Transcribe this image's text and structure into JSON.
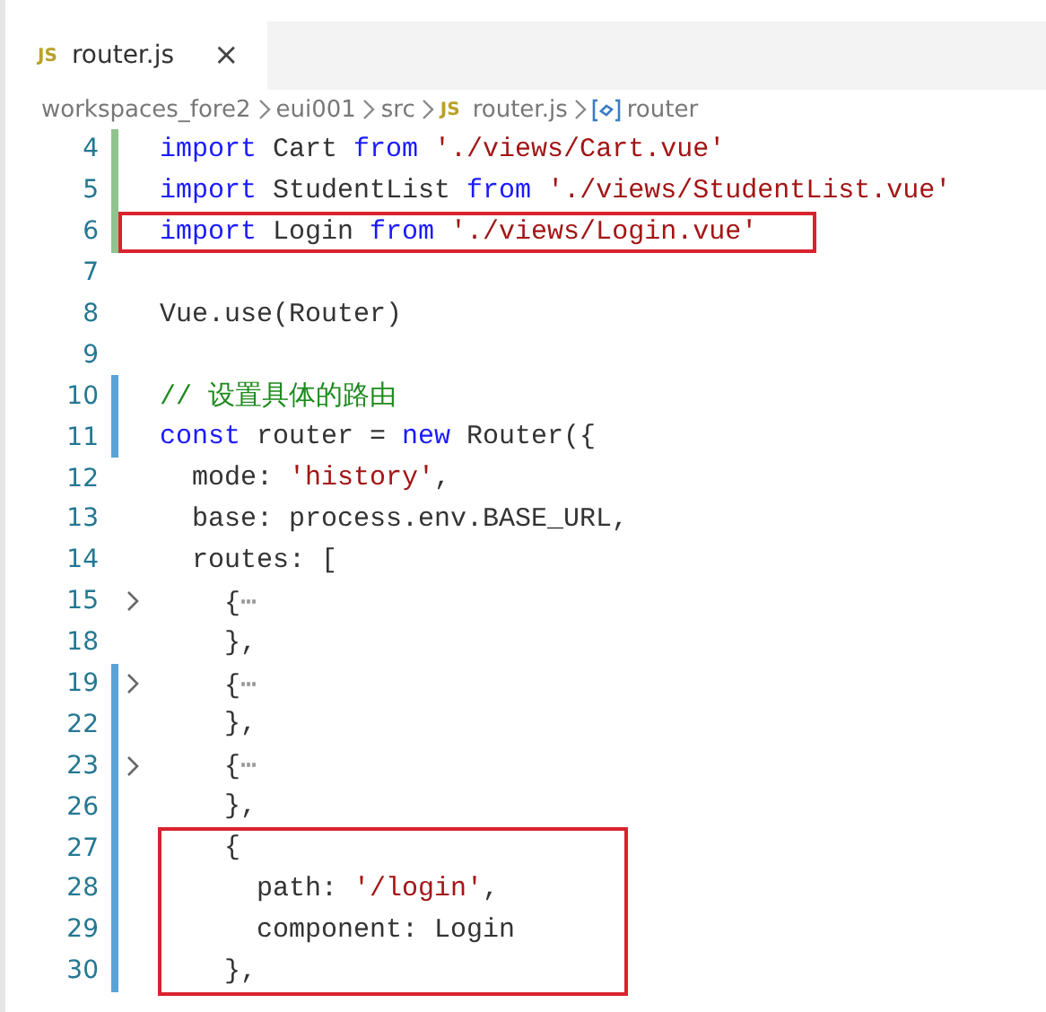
{
  "tabs": [
    {
      "badge": "JS",
      "label": "router.js",
      "close": "×",
      "selected": true
    }
  ],
  "breadcrumb": [
    {
      "kind": "folder",
      "text": "workspaces_fore2"
    },
    {
      "kind": "folder",
      "text": "eui001"
    },
    {
      "kind": "folder",
      "text": "src"
    },
    {
      "kind": "file",
      "badge": "JS",
      "text": "router.js"
    },
    {
      "kind": "symbol",
      "text": "router"
    }
  ],
  "lines": [
    {
      "number": "4",
      "added": true,
      "modified": false,
      "fold": false,
      "boxed": false,
      "tokens": [
        {
          "kind": "keyword",
          "text": "import"
        },
        {
          "kind": "plain",
          "text": " Cart "
        },
        {
          "kind": "keyword",
          "text": "from"
        },
        {
          "kind": "string",
          "text": " './views/Cart.vue'"
        }
      ]
    },
    {
      "number": "5",
      "added": true,
      "modified": false,
      "fold": false,
      "boxed": false,
      "tokens": [
        {
          "kind": "keyword",
          "text": "import"
        },
        {
          "kind": "plain",
          "text": " StudentList "
        },
        {
          "kind": "keyword",
          "text": "from"
        },
        {
          "kind": "string",
          "text": " './views/StudentList.vue'"
        }
      ]
    },
    {
      "number": "6",
      "added": true,
      "modified": false,
      "fold": false,
      "boxed": true,
      "tokens": [
        {
          "kind": "keyword",
          "text": "import"
        },
        {
          "kind": "plain",
          "text": " Login "
        },
        {
          "kind": "keyword",
          "text": "from"
        },
        {
          "kind": "string",
          "text": " './views/Login.vue'"
        }
      ]
    },
    {
      "number": "7",
      "added": false,
      "modified": false,
      "fold": false,
      "boxed": false
    },
    {
      "number": "8",
      "added": false,
      "modified": false,
      "fold": false,
      "boxed": false,
      "tokens": [
        {
          "kind": "plain",
          "text": "Vue.use(Router)"
        }
      ]
    },
    {
      "number": "9",
      "added": false,
      "modified": false,
      "fold": false,
      "boxed": false
    },
    {
      "number": "10",
      "added": false,
      "modified": true,
      "fold": false,
      "boxed": false,
      "tokens": [
        {
          "kind": "comment",
          "text": "// 设置具体的路由"
        }
      ]
    },
    {
      "number": "11",
      "added": false,
      "modified": true,
      "fold": false,
      "boxed": false,
      "tokens": [
        {
          "kind": "keyword",
          "text": "const"
        },
        {
          "kind": "plain",
          "text": " router = "
        },
        {
          "kind": "keyword",
          "text": "new"
        },
        {
          "kind": "plain",
          "text": " Router({"
        }
      ]
    },
    {
      "number": "12",
      "added": false,
      "modified": false,
      "fold": false,
      "boxed": false,
      "tokens": [
        {
          "kind": "plain",
          "text": "  mode: "
        },
        {
          "kind": "string",
          "text": "'history'"
        },
        {
          "kind": "plain",
          "text": ","
        }
      ]
    },
    {
      "number": "13",
      "added": false,
      "modified": false,
      "fold": false,
      "boxed": false,
      "tokens": [
        {
          "kind": "plain",
          "text": "  base: process.env.BASE_URL,"
        }
      ]
    },
    {
      "number": "14",
      "added": false,
      "modified": false,
      "fold": false,
      "boxed": false,
      "tokens": [
        {
          "kind": "plain",
          "text": "  routes: ["
        }
      ]
    },
    {
      "number": "15",
      "added": false,
      "modified": false,
      "fold": true,
      "boxed": false,
      "tokens": [
        {
          "kind": "plain",
          "text": "    {"
        },
        {
          "kind": "ellipsis",
          "text": "⋯"
        }
      ]
    },
    {
      "number": "18",
      "added": false,
      "modified": false,
      "fold": false,
      "boxed": false,
      "tokens": [
        {
          "kind": "plain",
          "text": "    },"
        }
      ]
    },
    {
      "number": "19",
      "added": false,
      "modified": true,
      "fold": true,
      "boxed": false,
      "tokens": [
        {
          "kind": "plain",
          "text": "    {"
        },
        {
          "kind": "ellipsis",
          "text": "⋯"
        }
      ]
    },
    {
      "number": "22",
      "added": false,
      "modified": true,
      "fold": false,
      "boxed": false,
      "tokens": [
        {
          "kind": "plain",
          "text": "    },"
        }
      ]
    },
    {
      "number": "23",
      "added": false,
      "modified": true,
      "fold": true,
      "boxed": false,
      "tokens": [
        {
          "kind": "plain",
          "text": "    {"
        },
        {
          "kind": "ellipsis",
          "text": "⋯"
        }
      ]
    },
    {
      "number": "26",
      "added": false,
      "modified": true,
      "fold": false,
      "boxed": false,
      "tokens": [
        {
          "kind": "plain",
          "text": "    },"
        }
      ]
    },
    {
      "number": "27",
      "added": false,
      "modified": true,
      "fold": false,
      "boxed": true,
      "tokens": [
        {
          "kind": "plain",
          "text": "    {"
        }
      ]
    },
    {
      "number": "28",
      "added": false,
      "modified": true,
      "fold": false,
      "boxed": true,
      "tokens": [
        {
          "kind": "plain",
          "text": "      path: "
        },
        {
          "kind": "string",
          "text": "'/login'"
        },
        {
          "kind": "plain",
          "text": ","
        }
      ]
    },
    {
      "number": "29",
      "added": false,
      "modified": true,
      "fold": false,
      "boxed": true,
      "tokens": [
        {
          "kind": "plain",
          "text": "      component: Login"
        }
      ]
    },
    {
      "number": "30",
      "added": false,
      "modified": true,
      "fold": false,
      "boxed": true,
      "tokens": [
        {
          "kind": "plain",
          "text": "    },"
        }
      ]
    }
  ]
}
